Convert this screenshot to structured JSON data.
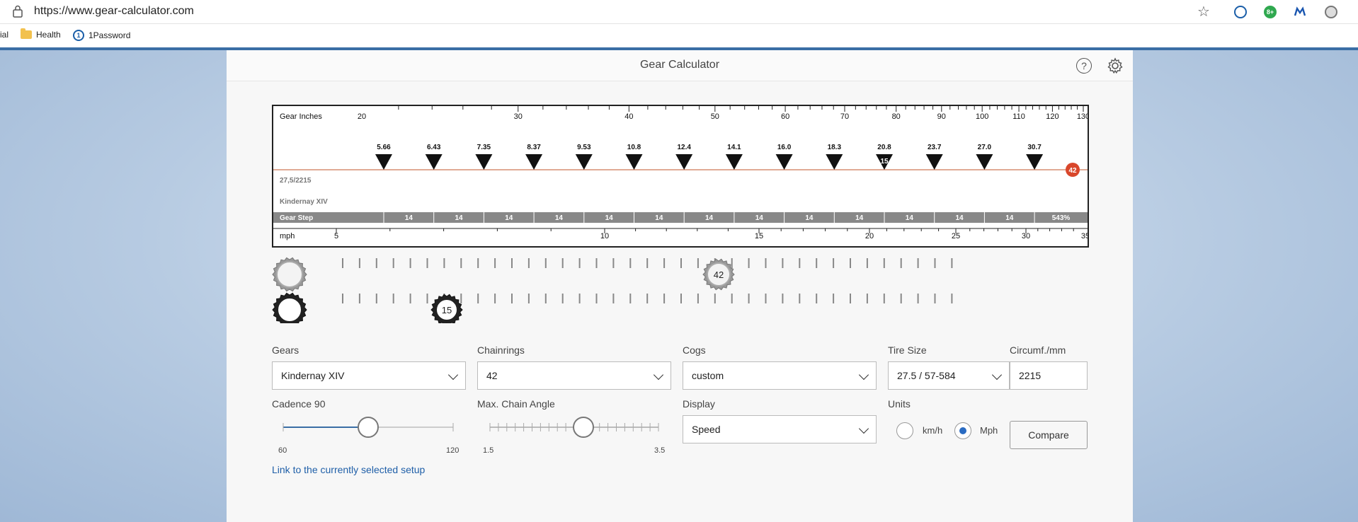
{
  "browser": {
    "url": "https://www.gear-calculator.com",
    "bookmarks": [
      "ial",
      "Health",
      "1Password"
    ],
    "extension_badge": "8+"
  },
  "app": {
    "title": "Gear Calculator",
    "help_icon": "help-icon",
    "settings_icon": "gear-icon"
  },
  "chart_data": {
    "type": "scatter",
    "top_axis_label": "Gear Inches",
    "top_ticks": [
      "20",
      "30",
      "40",
      "50",
      "60",
      "70",
      "80",
      "90",
      "100",
      "110",
      "120",
      "130"
    ],
    "gear_values": [
      "5.66",
      "6.43",
      "7.35",
      "8.37",
      "9.53",
      "10.8",
      "12.4",
      "14.1",
      "16.0",
      "18.3",
      "20.8",
      "23.7",
      "27.0",
      "30.7"
    ],
    "selected_cog_label": "15",
    "chainring_badge": "42",
    "wheel_label": "27,5/2215",
    "gears_label": "Kindernay XIV",
    "gear_step_label": "Gear Step",
    "gear_steps": [
      "14",
      "14",
      "14",
      "14",
      "14",
      "14",
      "14",
      "14",
      "14",
      "14",
      "14",
      "14",
      "14",
      "543%"
    ],
    "bottom_axis_label": "mph",
    "bottom_ticks": [
      "5",
      "10",
      "15",
      "20",
      "25",
      "30",
      "35"
    ]
  },
  "selectors": {
    "chainring_value": "42",
    "cog_value": "15"
  },
  "form": {
    "gears_label": "Gears",
    "gears_value": "Kindernay XIV",
    "chainrings_label": "Chainrings",
    "chainrings_value": "42",
    "cogs_label": "Cogs",
    "cogs_value": "custom",
    "tire_label": "Tire Size",
    "tire_value": "27.5 / 57-584",
    "circ_label": "Circumf./mm",
    "circ_value": "2215",
    "cadence_label": "Cadence 90",
    "cadence_min": "60",
    "cadence_max": "120",
    "cadence_value": 90,
    "chain_label": "Max. Chain Angle",
    "chain_min": "1.5",
    "chain_max": "3.5",
    "chain_value": 2.6,
    "display_label": "Display",
    "display_value": "Speed",
    "units_label": "Units",
    "unit_kmh": "km/h",
    "unit_mph": "Mph",
    "compare_label": "Compare",
    "link_text": "Link to the currently selected setup"
  }
}
